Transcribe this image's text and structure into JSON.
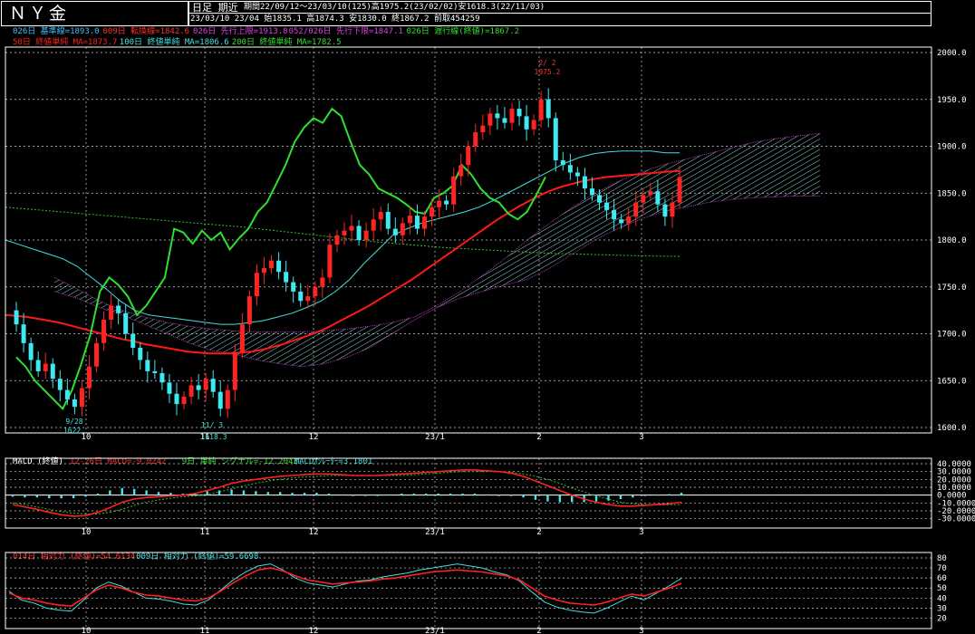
{
  "header": {
    "symbol": "ＮＹ金",
    "mode": "日足 期近",
    "period_line": "期間22/09/12～23/03/10(125)高1975.2(23/02/02)安1618.3(22/11/03)",
    "ohlc_line": "23/03/10 23/04 始1835.1 高1874.3 安1830.0 終1867.2 前取454259"
  },
  "legend_main_1": [
    {
      "text": "026日 基準線=1893.0",
      "color": "#40c0ff"
    },
    {
      "text": "009日 転換線=1842.6",
      "color": "#ff3030"
    },
    {
      "text": "026日 先行上限=1913.8",
      "color": "#e040e0"
    },
    {
      "text": "052/026日 先行下限=1847.1",
      "color": "#e040e0"
    },
    {
      "text": "026日 遅行線(終値)=1867.2",
      "color": "#30e030"
    }
  ],
  "legend_main_2": [
    {
      "text": "50日 終値単純 MA=1873.7",
      "color": "#ff2020"
    },
    {
      "text": "100日 終値単純 MA=1806.6",
      "color": "#40e0e0"
    },
    {
      "text": "200日 終値単純 MA=1782.5",
      "color": "#30e030"
    }
  ],
  "legend_macd": [
    {
      "text": "MACD (終値)",
      "color": "#ffffff"
    },
    {
      "text": "12-26日 MACD=-9.0242",
      "color": "#ff3030"
    },
    {
      "text": "9日 単純 シグナル=-12.2043",
      "color": "#30e030"
    },
    {
      "text": "MACDｵｼﾚｰﾀｰ=3.1801",
      "color": "#40e0e0"
    }
  ],
  "legend_rsi": [
    {
      "text": "014日 相対力 (終値)=54.6134",
      "color": "#ff3030"
    },
    {
      "text": "009日 相対力 (終値)=59.6698",
      "color": "#40e0e0"
    }
  ],
  "annotations": [
    {
      "text": "2/ 2",
      "color": "#ff3030"
    },
    {
      "text": "1975.2",
      "color": "#ff3030"
    },
    {
      "text": "9/28",
      "color": "#40e0e0"
    },
    {
      "text": "1622.",
      "color": "#40e0e0"
    },
    {
      "text": "11/ 3",
      "color": "#40e0e0"
    },
    {
      "text": "1618.3",
      "color": "#40e0e0"
    }
  ],
  "chart_data": [
    {
      "type": "candlestick",
      "yaxis": {
        "ticks": [
          "2000.0",
          "1950.0",
          "1900.0",
          "1850.0",
          "1800.0",
          "1750.0",
          "1700.0",
          "1650.0",
          "1600.0"
        ],
        "range": [
          1600,
          2000
        ]
      },
      "x_labels": [
        "10",
        "11",
        "12",
        "23/1",
        "2",
        "3"
      ],
      "grid": true,
      "high": 1975.2,
      "low": 1618.3,
      "close_series": [
        1725,
        1710,
        1690,
        1672,
        1660,
        1668,
        1652,
        1640,
        1630,
        1622,
        1642,
        1665,
        1690,
        1715,
        1730,
        1722,
        1700,
        1685,
        1672,
        1660,
        1658,
        1648,
        1636,
        1625,
        1633,
        1645,
        1640,
        1652,
        1638,
        1620,
        1640,
        1680,
        1710,
        1740,
        1765,
        1770,
        1778,
        1766,
        1755,
        1745,
        1735,
        1740,
        1750,
        1760,
        1795,
        1805,
        1810,
        1815,
        1800,
        1810,
        1822,
        1830,
        1812,
        1805,
        1818,
        1826,
        1812,
        1825,
        1835,
        1842,
        1838,
        1868,
        1880,
        1900,
        1915,
        1922,
        1935,
        1930,
        1925,
        1940,
        1932,
        1918,
        1928,
        1950,
        1930,
        1885,
        1880,
        1872,
        1868,
        1855,
        1848,
        1840,
        1832,
        1822,
        1818,
        1825,
        1840,
        1848,
        1852,
        1838,
        1825,
        1840,
        1867.2
      ],
      "ma50": [
        1720,
        1719,
        1718,
        1716,
        1714,
        1712,
        1709,
        1706,
        1703,
        1700,
        1697,
        1694,
        1692,
        1689,
        1687,
        1685,
        1683,
        1681,
        1680,
        1679,
        1679,
        1679,
        1680,
        1681,
        1683,
        1686,
        1689,
        1693,
        1697,
        1701,
        1706,
        1712,
        1718,
        1724,
        1730,
        1737,
        1744,
        1751,
        1758,
        1766,
        1774,
        1782,
        1790,
        1798,
        1806,
        1814,
        1822,
        1829,
        1836,
        1842,
        1848,
        1853,
        1857,
        1860,
        1863,
        1865,
        1867,
        1868,
        1869,
        1870,
        1871,
        1872,
        1873,
        1873.7
      ],
      "ma100": [
        1800,
        1795,
        1790,
        1785,
        1780,
        1772,
        1760,
        1748,
        1735,
        1725,
        1720,
        1718,
        1716,
        1714,
        1712,
        1710,
        1710,
        1712,
        1714,
        1718,
        1722,
        1728,
        1735,
        1745,
        1758,
        1775,
        1790,
        1805,
        1812,
        1818,
        1822,
        1826,
        1830,
        1835,
        1842,
        1850,
        1858,
        1866,
        1874,
        1882,
        1888,
        1892,
        1894,
        1895,
        1895,
        1895,
        1893,
        1893.0
      ],
      "ma200": [
        1835,
        1832,
        1829,
        1826,
        1823,
        1820,
        1817,
        1814,
        1810,
        1806,
        1802,
        1798,
        1795,
        1792,
        1790,
        1788,
        1786,
        1785,
        1784,
        1783,
        1782.5
      ],
      "chikou": [
        1675,
        1665,
        1650,
        1640,
        1630,
        1620,
        1640,
        1668,
        1700,
        1745,
        1760,
        1752,
        1740,
        1720,
        1730,
        1745,
        1760,
        1812,
        1808,
        1796,
        1810,
        1800,
        1808,
        1790,
        1802,
        1812,
        1830,
        1840,
        1860,
        1880,
        1905,
        1920,
        1930,
        1925,
        1940,
        1932,
        1905,
        1880,
        1870,
        1855,
        1850,
        1845,
        1838,
        1830,
        1828,
        1845,
        1850,
        1858,
        1880,
        1870,
        1855,
        1845,
        1840,
        1828,
        1822,
        1830,
        1848,
        1867.2
      ],
      "kumo_upper": [
        1760,
        1748,
        1735,
        1725,
        1718,
        1712,
        1708,
        1705,
        1703,
        1702,
        1702,
        1702,
        1703,
        1705,
        1708,
        1712,
        1718,
        1730,
        1745,
        1762,
        1780,
        1800,
        1818,
        1835,
        1850,
        1862,
        1872,
        1880,
        1886,
        1892,
        1898,
        1904,
        1908,
        1911,
        1913.8
      ],
      "kumo_lower": [
        1745,
        1738,
        1728,
        1720,
        1710,
        1700,
        1690,
        1682,
        1678,
        1672,
        1668,
        1665,
        1668,
        1675,
        1685,
        1700,
        1715,
        1728,
        1738,
        1745,
        1752,
        1758,
        1770,
        1785,
        1800,
        1812,
        1822,
        1830,
        1835,
        1840,
        1843,
        1845,
        1846,
        1847,
        1847.1
      ]
    },
    {
      "type": "line",
      "name_label": "MACD",
      "yaxis": {
        "ticks": [
          "40.0000",
          "30.0000",
          "20.0000",
          "10.0000",
          "0.0000",
          "-10.0000",
          "-20.0000",
          "-30.0000"
        ],
        "range": [
          -35,
          40
        ]
      },
      "macd": [
        -12,
        -15,
        -18,
        -22,
        -25,
        -27,
        -26,
        -22,
        -16,
        -9,
        -5,
        -3,
        -2,
        -1,
        0,
        2,
        6,
        10,
        15,
        18,
        20,
        22,
        24,
        25,
        26,
        27,
        27,
        26,
        25,
        25,
        25,
        26,
        27,
        28,
        29,
        30,
        31,
        32,
        32,
        31,
        30,
        28,
        24,
        18,
        12,
        6,
        0,
        -5,
        -9,
        -12,
        -14,
        -14,
        -13,
        -12,
        -11,
        -9.0242
      ],
      "signal": [
        -10,
        -12,
        -15,
        -18,
        -21,
        -23,
        -24,
        -24,
        -22,
        -18,
        -13,
        -9,
        -6,
        -4,
        -2,
        -1,
        1,
        4,
        8,
        12,
        15,
        18,
        20,
        22,
        23,
        24,
        25,
        25,
        25,
        25,
        25,
        25,
        25,
        26,
        27,
        28,
        29,
        30,
        30,
        30,
        30,
        29,
        27,
        24,
        20,
        15,
        9,
        4,
        -1,
        -5,
        -9,
        -11,
        -12,
        -12.5,
        -12.3,
        -12.2043
      ],
      "oscillator": [
        -2,
        -3,
        -3,
        -4,
        -4,
        -4,
        -2,
        2,
        6,
        9,
        8,
        6,
        4,
        3,
        2,
        3,
        5,
        6,
        7,
        6,
        5,
        4,
        4,
        3,
        3,
        3,
        2,
        1,
        0,
        0,
        0,
        1,
        2,
        2,
        2,
        2,
        2,
        2,
        2,
        1,
        0,
        -1,
        -3,
        -6,
        -8,
        -9,
        -9,
        -9,
        -8,
        -7,
        -5,
        -3,
        -1,
        0.5,
        1.3,
        3.1801
      ]
    },
    {
      "type": "line",
      "name_label": "RSI",
      "yaxis": {
        "ticks": [
          "80",
          "70",
          "60",
          "50",
          "40",
          "30",
          "20"
        ],
        "range": [
          15,
          80
        ]
      },
      "rsi14": [
        45,
        40,
        38,
        35,
        33,
        32,
        40,
        48,
        53,
        50,
        46,
        43,
        42,
        40,
        38,
        37,
        40,
        47,
        55,
        62,
        68,
        70,
        67,
        62,
        58,
        56,
        54,
        55,
        56,
        57,
        59,
        60,
        62,
        64,
        66,
        67,
        68,
        67,
        66,
        64,
        62,
        58,
        50,
        42,
        38,
        35,
        34,
        33,
        36,
        40,
        44,
        42,
        46,
        50,
        54.6134
      ],
      "rsi9": [
        47,
        38,
        35,
        30,
        28,
        27,
        38,
        50,
        56,
        52,
        46,
        40,
        39,
        37,
        34,
        33,
        38,
        48,
        58,
        66,
        72,
        74,
        68,
        60,
        55,
        53,
        51,
        54,
        57,
        58,
        61,
        63,
        65,
        68,
        70,
        72,
        74,
        72,
        70,
        66,
        63,
        57,
        46,
        36,
        31,
        28,
        26,
        25,
        30,
        36,
        42,
        38,
        45,
        52,
        59.6698
      ]
    }
  ]
}
